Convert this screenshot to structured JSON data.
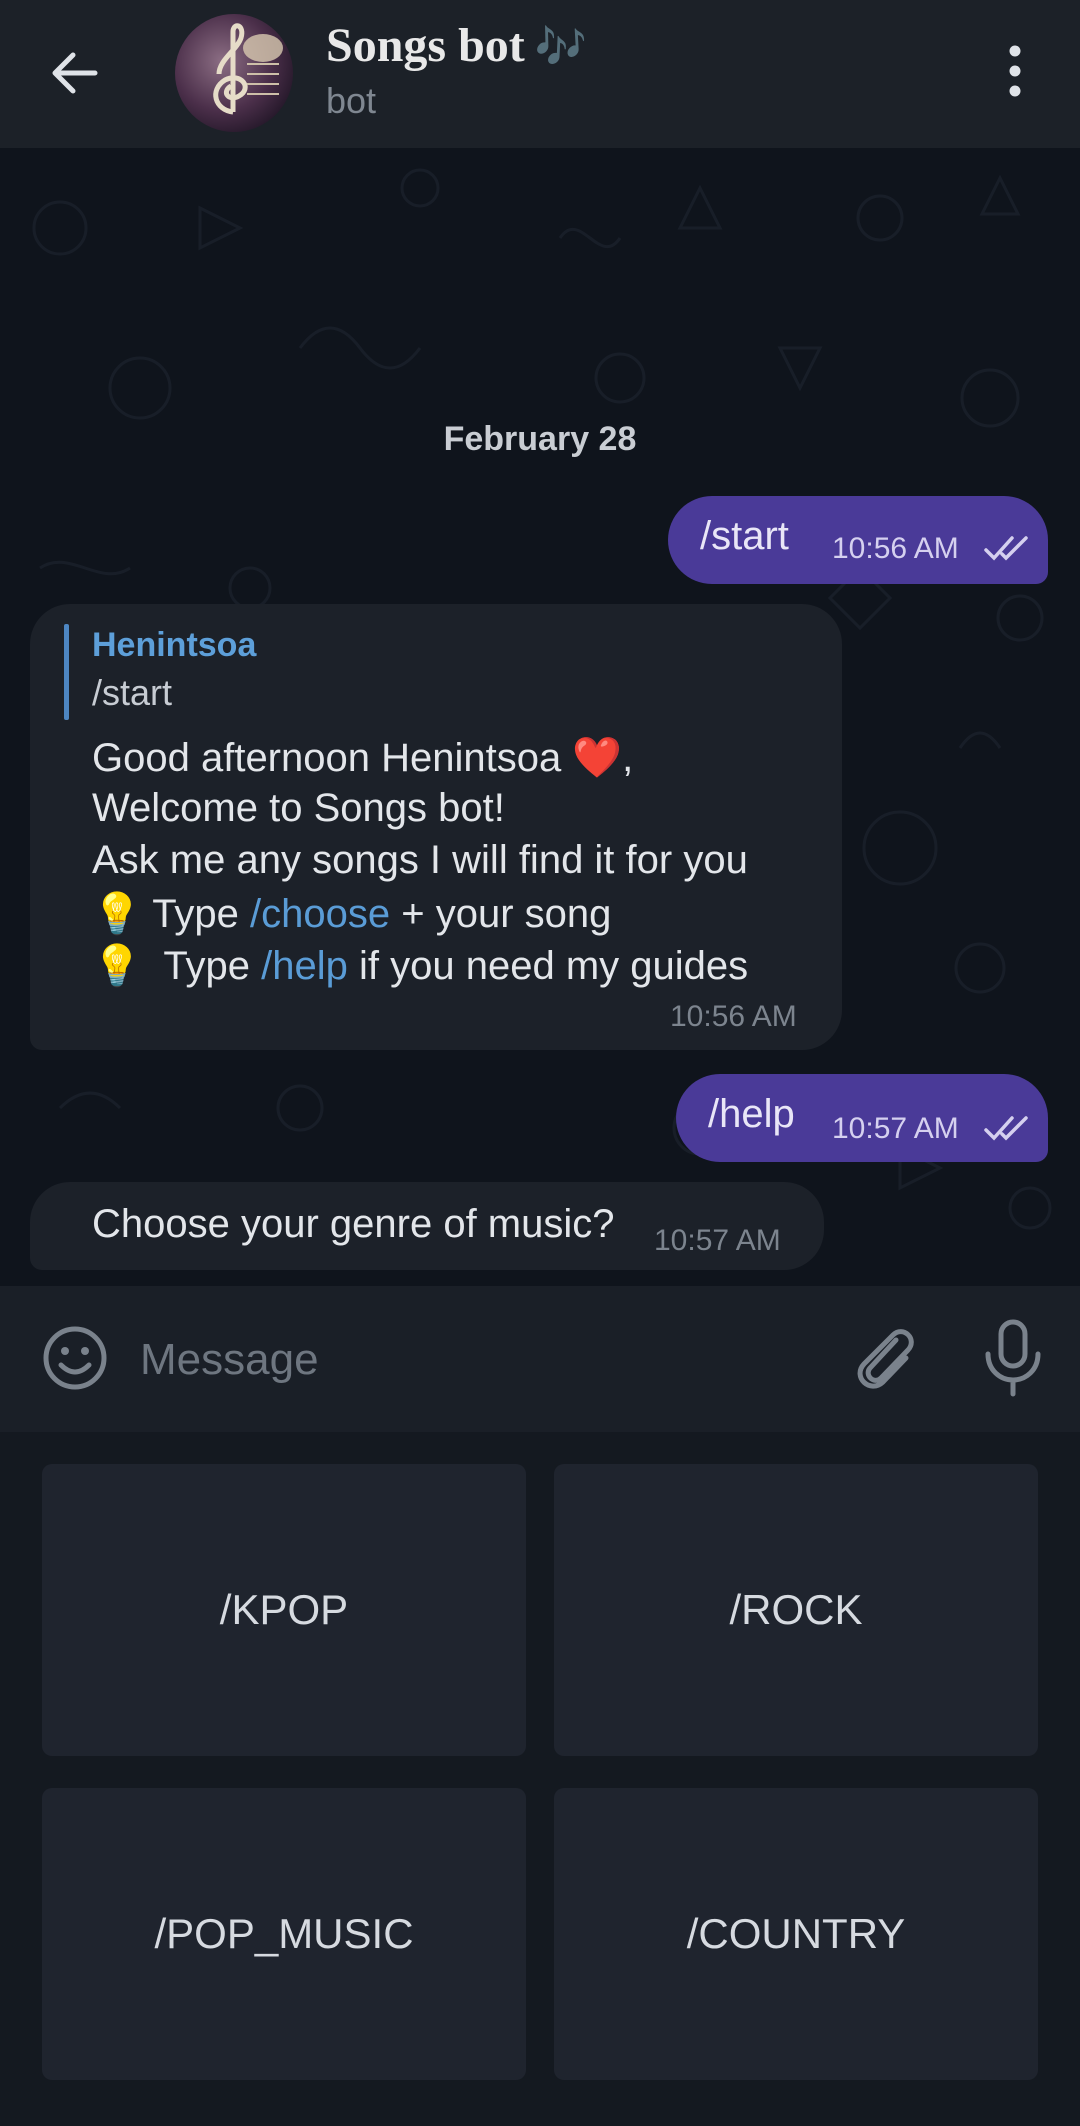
{
  "header": {
    "title": "Songs bot",
    "title_emoji": "🎶",
    "subtitle": "bot",
    "back_icon": "arrow-left-icon",
    "menu_icon": "more-vertical-icon"
  },
  "chat": {
    "date": "February 28",
    "messages": [
      {
        "text": "/start",
        "time": "10:56 AM"
      },
      {
        "reply_name": "Henintsoa",
        "reply_text": "/start",
        "line1": "Good afternoon Henintsoa",
        "heart": "❤️",
        "line1_end": ",",
        "line2": "Welcome to Songs bot!",
        "line3": "Ask me any songs I will find it for you",
        "bulb": "💡",
        "line4_pre": "Type",
        "line4_link": "/choose",
        "line4_post": "+ your song",
        "line5_pre": "Type",
        "line5_link": "/help",
        "line5_post": "if you need my guides",
        "time": "10:56 AM"
      },
      {
        "text": "/help",
        "time": "10:57 AM"
      },
      {
        "text": "Choose your genre of music?",
        "time": "10:57 AM"
      }
    ]
  },
  "input": {
    "placeholder": "Message",
    "emoji_icon": "smile-icon",
    "attach_icon": "paperclip-icon",
    "mic_icon": "microphone-icon"
  },
  "keyboard": {
    "buttons": [
      "/KPOP",
      "/ROCK",
      "/POP_MUSIC",
      "/COUNTRY"
    ]
  },
  "colors": {
    "outgoing_bubble": "#4a3a98",
    "incoming_bubble": "#1c2129",
    "link": "#5a9cd6",
    "header_bg": "#1c2128"
  }
}
